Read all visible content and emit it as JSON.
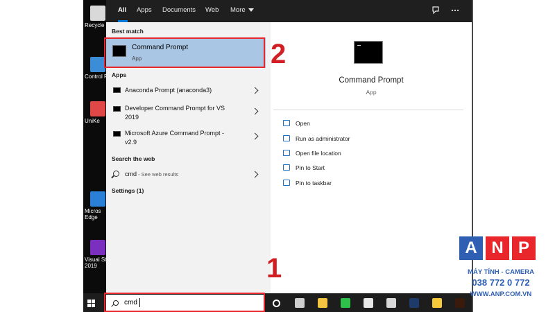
{
  "desktop": {
    "icons": [
      {
        "label": "Recycle",
        "color": "#d9d9d9"
      },
      {
        "label": "Control P",
        "color": "#3c8dd8"
      },
      {
        "label": "UniKe",
        "color": "#e04848"
      },
      {
        "label": "Micros\nEdge",
        "color": "#2a7fd6"
      },
      {
        "label": "Visual St\n2019",
        "color": "#7b2fbe"
      }
    ]
  },
  "search_tabs": {
    "all": "All",
    "apps": "Apps",
    "documents": "Documents",
    "web": "Web",
    "more": "More"
  },
  "best_match": {
    "heading": "Best match",
    "title": "Command Prompt",
    "subtitle": "App"
  },
  "apps_section": {
    "heading": "Apps",
    "items": [
      {
        "line1": "Anaconda Prompt (anaconda3)",
        "line2": ""
      },
      {
        "line1": "Developer Command Prompt for VS",
        "line2": "2019"
      },
      {
        "line1": "Microsoft Azure Command Prompt -",
        "line2": "v2.9"
      }
    ]
  },
  "web_section": {
    "heading": "Search the web",
    "query": "cmd",
    "suffix": " - See web results"
  },
  "settings_section": {
    "heading": "Settings (1)"
  },
  "detail": {
    "title": "Command Prompt",
    "subtitle": "App",
    "actions": [
      "Open",
      "Run as administrator",
      "Open file location",
      "Pin to Start",
      "Pin to taskbar"
    ]
  },
  "taskbar": {
    "search_value": "cmd",
    "icons": [
      {
        "name": "cortana-icon",
        "color": "#ffffff"
      },
      {
        "name": "task-view-icon",
        "color": "#cfcfcf"
      },
      {
        "name": "file-explorer-icon",
        "color": "#f4c542"
      },
      {
        "name": "line-icon",
        "color": "#2fc24a"
      },
      {
        "name": "slack-icon",
        "color": "#e8e8e8"
      },
      {
        "name": "paint-icon",
        "color": "#d9d9d9"
      },
      {
        "name": "photoshop-icon",
        "color": "#1d3a6b"
      },
      {
        "name": "notes-icon",
        "color": "#f6c93a"
      },
      {
        "name": "illustrator-icon",
        "color": "#3a1a0b"
      }
    ]
  },
  "annotations": {
    "step1": "1",
    "step2": "2",
    "color": "#e8262b"
  },
  "watermark": {
    "letters": [
      "A",
      "N",
      "P"
    ],
    "letter_colors": [
      "#2e5fb3",
      "#e8262b",
      "#e8262b"
    ],
    "line1": "MÁY TÍNH - CAMERA",
    "line2": "038 772 0 772",
    "line3": "WWW.ANP.COM.VN",
    "text_color": "#2e5fb3"
  }
}
